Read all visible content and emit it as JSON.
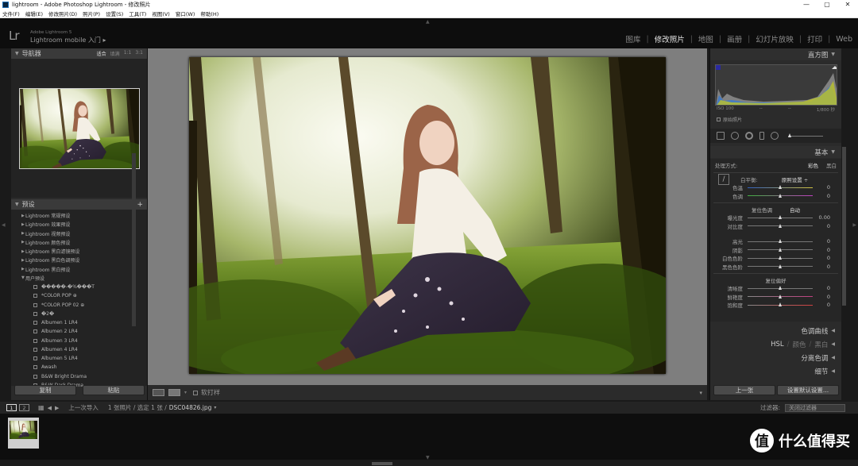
{
  "window": {
    "title": "lightroom - Adobe Photoshop Lightroom - 修改照片",
    "controls": [
      "—",
      "▢",
      "✕"
    ]
  },
  "menu": [
    "文件(F)",
    "编辑(E)",
    "修改照片(D)",
    "照片(P)",
    "设置(S)",
    "工具(T)",
    "视图(V)",
    "窗口(W)",
    "帮助(H)"
  ],
  "header": {
    "logo": "Lr",
    "version": "Adobe Lightroom 5",
    "identity": "Lightroom mobile 入门",
    "identity_arrow": "▸",
    "modules": [
      "图库",
      "修改照片",
      "地图",
      "画册",
      "幻灯片放映",
      "打印",
      "Web"
    ],
    "active_module": "修改照片"
  },
  "navigator": {
    "title": "导航器",
    "options": [
      "适合",
      "填满",
      "1:1",
      "3:1"
    ],
    "selected_option": "适合"
  },
  "presets": {
    "title": "预设",
    "add": "+",
    "items": [
      {
        "label": "Lightroom 常规预设",
        "type": "folder"
      },
      {
        "label": "Lightroom 效果预设",
        "type": "folder"
      },
      {
        "label": "Lightroom 视频预设",
        "type": "folder"
      },
      {
        "label": "Lightroom 颜色预设",
        "type": "folder"
      },
      {
        "label": "Lightroom 黑白滤镜预设",
        "type": "folder"
      },
      {
        "label": "Lightroom 黑白色调预设",
        "type": "folder"
      },
      {
        "label": "Lightroom 黑白预设",
        "type": "folder"
      },
      {
        "label": "用户预设",
        "type": "open-folder"
      },
      {
        "label": "�����-�%���T",
        "type": "child"
      },
      {
        "label": "*COLOR POP ⊕",
        "type": "child"
      },
      {
        "label": "*COLOR POP 02 ⊕",
        "type": "child"
      },
      {
        "label": "�2�",
        "type": "child"
      },
      {
        "label": "Albumen 1 LR4",
        "type": "child"
      },
      {
        "label": "Albumen 2 LR4",
        "type": "child"
      },
      {
        "label": "Albumen 3 LR4",
        "type": "child"
      },
      {
        "label": "Albumen 4 LR4",
        "type": "child"
      },
      {
        "label": "Albumen 5 LR4",
        "type": "child"
      },
      {
        "label": "Awash",
        "type": "child"
      },
      {
        "label": "B&W Bright Drama",
        "type": "child"
      },
      {
        "label": "B&W Dark Drama",
        "type": "child"
      }
    ]
  },
  "left_buttons": {
    "copy": "复制",
    "paste": "粘贴"
  },
  "toolbar": {
    "softproof": "软打样",
    "dropdown": "▾"
  },
  "histogram": {
    "title": "直方图",
    "iso": "ISO 100",
    "dash1": "--",
    "dash2": "--",
    "shutter": "1/800 秒",
    "original_photo": "原始照片"
  },
  "basic": {
    "title": "基本",
    "treatment_label": "处理方式:",
    "treatment_color": "彩色",
    "treatment_bw": "黑白",
    "wb_label": "白平衡:",
    "wb_value": "原照设置 ÷",
    "temp": {
      "label": "色温",
      "value": "0",
      "pos": 0.5
    },
    "tint": {
      "label": "色调",
      "value": "0",
      "pos": 0.5
    },
    "tone_label": "复位色调",
    "auto": "自动",
    "tone": [
      {
        "label": "曝光度",
        "value": "0.00",
        "pos": 0.5
      },
      {
        "label": "对比度",
        "value": "0",
        "pos": 0.5
      },
      {
        "label": "高光",
        "value": "0",
        "pos": 0.5
      },
      {
        "label": "阴影",
        "value": "0",
        "pos": 0.5
      },
      {
        "label": "白色色阶",
        "value": "0",
        "pos": 0.5
      },
      {
        "label": "黑色色阶",
        "value": "0",
        "pos": 0.5
      }
    ],
    "presence_label": "复位偏好",
    "presence": [
      {
        "label": "清晰度",
        "value": "0",
        "pos": 0.5
      },
      {
        "label": "鲜艳度",
        "value": "0",
        "pos": 0.5
      },
      {
        "label": "饱和度",
        "value": "0",
        "pos": 0.5
      }
    ]
  },
  "collapsed_panels": {
    "tone_curve": "色调曲线",
    "hsl": "HSL",
    "hsl_color": "颜色",
    "hsl_bw": "黑白",
    "split_toning": "分离色调",
    "detail": "细节"
  },
  "right_buttons": {
    "previous": "上一张",
    "reset": "设置默认设置..."
  },
  "filmbar": {
    "page1": "1",
    "page2": "2",
    "source": "上一次导入",
    "info": "1 张照片 / 选定 1 张 /",
    "filename": "DSC04826.jpg",
    "filter_label": "过滤器:",
    "filter_value": "关闭过滤器"
  },
  "watermark": {
    "logo": "值",
    "text": "什么值得买"
  },
  "colors": {
    "accent_active": "#e2e2e2",
    "panel": "#2b2b2b",
    "bg": "#1a1a1a"
  }
}
